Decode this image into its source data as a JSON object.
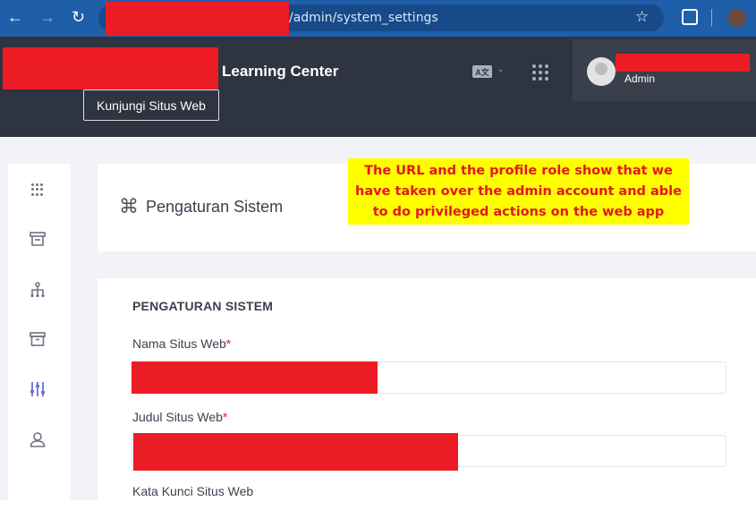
{
  "browser": {
    "url_path": "/admin/system_settings",
    "back_icon": "←",
    "forward_icon": "→",
    "reload_icon": "↻",
    "star_icon": "☆"
  },
  "header": {
    "brand_suffix": "Learning Center",
    "visit_site_label": "Kunjungi Situs Web",
    "lang_icon_text": "A文",
    "lang_chevron": "⌄",
    "user_role": "Admin"
  },
  "sidebar": {
    "icons": [
      "apps-icon",
      "inbox-icon",
      "hierarchy-icon",
      "archive-icon",
      "sliders-icon",
      "user-icon"
    ]
  },
  "page": {
    "title_icon": "⌘",
    "title": "Pengaturan Sistem"
  },
  "callout": {
    "text": "The URL and the profile role show that we have taken over the admin account and able to do privileged actions on the web app"
  },
  "form": {
    "section_heading": "PENGATURAN SISTEM",
    "fields": [
      {
        "label": "Nama Situs Web",
        "required_mark": "*"
      },
      {
        "label": "Judul Situs Web",
        "required_mark": "*"
      },
      {
        "label": "Kata Kunci Situs Web"
      }
    ]
  },
  "colors": {
    "browser_bar": "#1f5ea8",
    "header_bg": "#2e3440",
    "redaction": "#ec1c24",
    "callout_bg": "#ffff00",
    "accent": "#6a72d6"
  }
}
